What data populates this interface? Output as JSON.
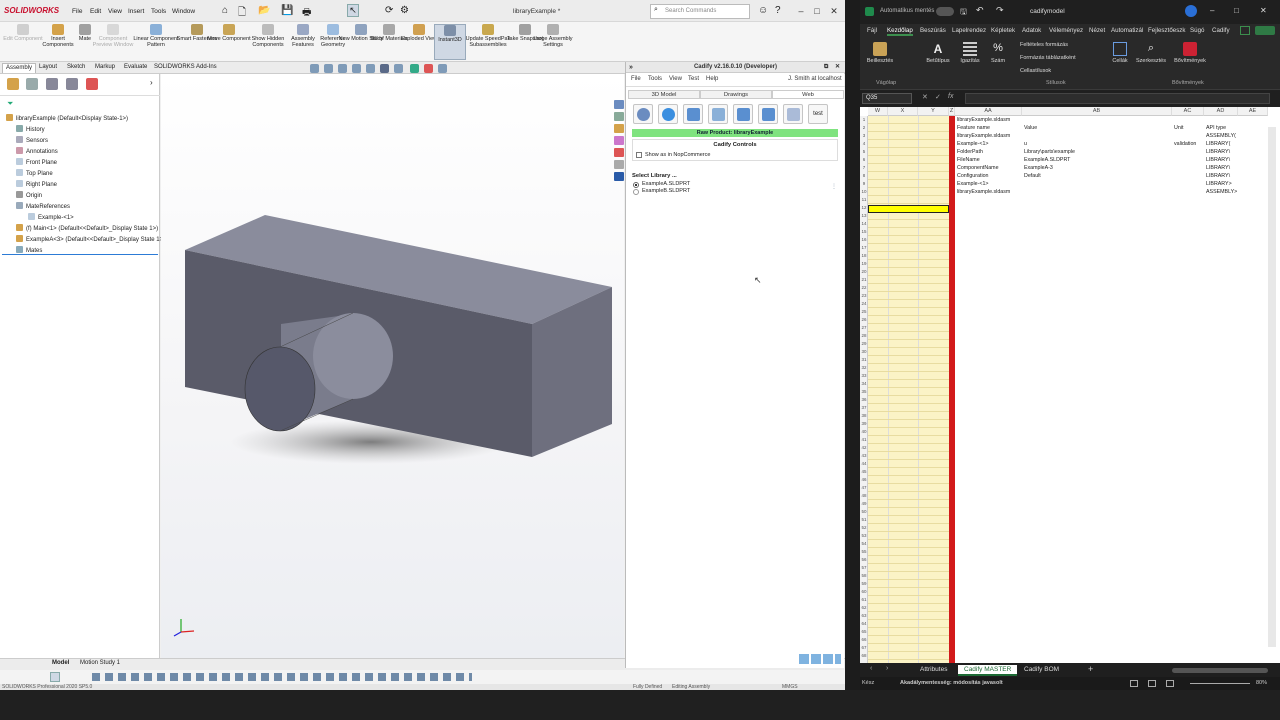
{
  "solidworks": {
    "logo": "SOLIDWORKS",
    "menus": [
      "File",
      "Edit",
      "View",
      "Insert",
      "Tools",
      "Window"
    ],
    "doc_title": "libraryExample *",
    "search_placeholder": "Search Commands",
    "commands": [
      {
        "label": "Edit Component",
        "disabled": true
      },
      {
        "label": "Insert Components",
        "disabled": false
      },
      {
        "label": "Mate",
        "disabled": false
      },
      {
        "label": "Component Preview Window",
        "disabled": true
      },
      {
        "label": "Linear Component Pattern",
        "disabled": false
      },
      {
        "label": "Smart Fasteners",
        "disabled": false
      },
      {
        "label": "Move Component",
        "disabled": false
      },
      {
        "label": "Show Hidden Components",
        "disabled": false
      },
      {
        "label": "Assembly Features",
        "disabled": false
      },
      {
        "label": "Reference Geometry",
        "disabled": false
      },
      {
        "label": "New Motion Study",
        "disabled": false
      },
      {
        "label": "Bill of Materials",
        "disabled": false
      },
      {
        "label": "Exploded View",
        "disabled": false
      },
      {
        "label": "Instant3D",
        "disabled": false
      },
      {
        "label": "Update SpeedPak Subassemblies",
        "disabled": false
      },
      {
        "label": "Take Snapshot",
        "disabled": false
      },
      {
        "label": "Large Assembly Settings",
        "disabled": false
      }
    ],
    "tabs": [
      "Assembly",
      "Layout",
      "Sketch",
      "Markup",
      "Evaluate",
      "SOLIDWORKS Add-Ins"
    ],
    "selected_tab": "Assembly",
    "tree": [
      {
        "label": "libraryExample  (Default<Display State-1>)",
        "indent": 0
      },
      {
        "label": "History",
        "indent": 1
      },
      {
        "label": "Sensors",
        "indent": 1
      },
      {
        "label": "Annotations",
        "indent": 1
      },
      {
        "label": "Front Plane",
        "indent": 1
      },
      {
        "label": "Top Plane",
        "indent": 1
      },
      {
        "label": "Right Plane",
        "indent": 1
      },
      {
        "label": "Origin",
        "indent": 1
      },
      {
        "label": "MateReferences",
        "indent": 1
      },
      {
        "label": "Example-<1>",
        "indent": 2
      },
      {
        "label": "(f) Main<1> (Default<<Default>_Display State 1>)",
        "indent": 1
      },
      {
        "label": "ExampleA<3> (Default<<Default>_Display State 1>)",
        "indent": 1
      },
      {
        "label": "Mates",
        "indent": 1
      }
    ],
    "bottom_tabs": [
      "Model",
      "Motion Study 1"
    ],
    "status_left": "SOLIDWORKS Professional 2020 SP5.0",
    "status_mid": "Fully Defined",
    "status_mid2": "Editing Assembly",
    "units": "MMGS"
  },
  "cadify": {
    "title": "Cadify v2.16.0.10 (Developer)",
    "menus": [
      "File",
      "Tools",
      "View",
      "Test",
      "Help"
    ],
    "user": "J. Smith at localhost",
    "tabs": [
      "3D Model",
      "Drawings",
      "Web"
    ],
    "selected_tab": "Web",
    "test_button": "test",
    "raw_product": "Raw Product: libraryExample",
    "controls_title": "Cadify Controls",
    "show_nopcommerce": "Show as in NopCommerce",
    "select_library": "Select Library ...",
    "library_options": [
      "ExampleA.SLDPRT",
      "ExampleB.SLDPRT"
    ],
    "selected_library": "ExampleA.SLDPRT"
  },
  "excel": {
    "autosave": "Automatikus mentés",
    "file_title": "cadifymodel",
    "ribbon_tabs": [
      "Fájl",
      "Kezdőlap",
      "Beszúrás",
      "Lapelrendez",
      "Képletek",
      "Adatok",
      "Véleményez",
      "Nézet",
      "Automatizál",
      "Fejlesztőeszk",
      "Súgó",
      "Cadify"
    ],
    "selected_ribbon_tab": "Kezdőlap",
    "ribbon_buttons": [
      "Beillesztés",
      "Betűtípus",
      "Igazítás",
      "Szám",
      "Feltételes formázás",
      "Formázás táblázatként",
      "Cellastílusok",
      "Cellák",
      "Szerkesztés",
      "Bővítmények"
    ],
    "groups": [
      "Vágólap",
      "Stílusok",
      "Bővítmények"
    ],
    "name_box": "Q35",
    "columns": [
      "W",
      "X",
      "Y",
      "Z",
      "AA",
      "AB",
      "AC",
      "AD",
      "AE"
    ],
    "rows": [
      [
        "libraryExample.sldasm",
        "",
        "",
        ""
      ],
      [
        "Feature name",
        "Value",
        "Unit",
        "API type"
      ],
      [
        "libraryExample.sldasm",
        "",
        "",
        "ASSEMBLY("
      ],
      [
        "Example-<1>",
        "u",
        "validation",
        "LIBRARY("
      ],
      [
        "FolderPath",
        "Library\\parts\\example",
        "",
        "LIBRARY\\"
      ],
      [
        "FileName",
        "ExampleA.SLDPRT",
        "",
        "LIBRARY\\"
      ],
      [
        "ComponentName",
        "ExampleA-3",
        "",
        "LIBRARY\\"
      ],
      [
        "Configuration",
        "Default",
        "",
        "LIBRARY\\"
      ],
      [
        "Example-<1>",
        "",
        "",
        "LIBRARY>"
      ],
      [
        "libraryExample.sldasm",
        "",
        "",
        "ASSEMBLY>"
      ]
    ],
    "sheet_tabs": [
      "Attributes",
      "Cadify MASTER",
      "Cadify BOM"
    ],
    "selected_sheet": "Cadify MASTER",
    "status_ready": "Kész",
    "status_accessibility": "Akadálymentesség: módosítás javasolt",
    "zoom": "80%"
  }
}
